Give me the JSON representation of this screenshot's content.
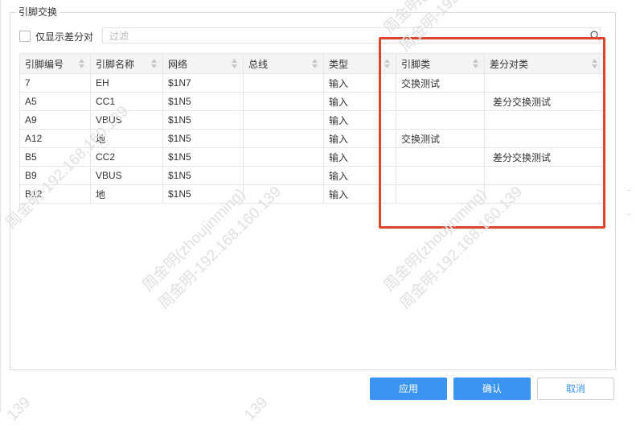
{
  "group": {
    "title": "引脚交换"
  },
  "filter": {
    "checkbox_label": "仅显示差分对",
    "placeholder": "过滤"
  },
  "table": {
    "columns": [
      "引脚编号",
      "引脚名称",
      "网络",
      "总线",
      "类型",
      "引脚类",
      "差分对类"
    ],
    "rows": [
      [
        "7",
        "EH",
        "$1N7",
        "",
        "输入",
        "交换测试",
        ""
      ],
      [
        "A5",
        "CC1",
        "$1N5",
        "",
        "输入",
        "",
        "差分交换测试"
      ],
      [
        "A9",
        "VBUS",
        "$1N5",
        "",
        "输入",
        "",
        ""
      ],
      [
        "A12",
        "地",
        "$1N5",
        "",
        "输入",
        "交换测试",
        ""
      ],
      [
        "B5",
        "CC2",
        "$1N5",
        "",
        "输入",
        "",
        "差分交换测试"
      ],
      [
        "B9",
        "VBUS",
        "$1N5",
        "",
        "输入",
        "",
        ""
      ],
      [
        "B12",
        "地",
        "$1N5",
        "",
        "输入",
        "",
        ""
      ]
    ]
  },
  "buttons": {
    "apply": "应用",
    "confirm": "确认",
    "cancel": "取消"
  },
  "watermarks": {
    "name": "周金明(zhoujinming)",
    "ip": "周金明-192.168.160.139",
    "fragment": "139"
  },
  "colors": {
    "accent": "#3a94f0",
    "highlight": "#d9452b"
  },
  "icons": {
    "search": "search-icon",
    "sort": "sort-icon",
    "checkbox": "checkbox-unchecked"
  }
}
